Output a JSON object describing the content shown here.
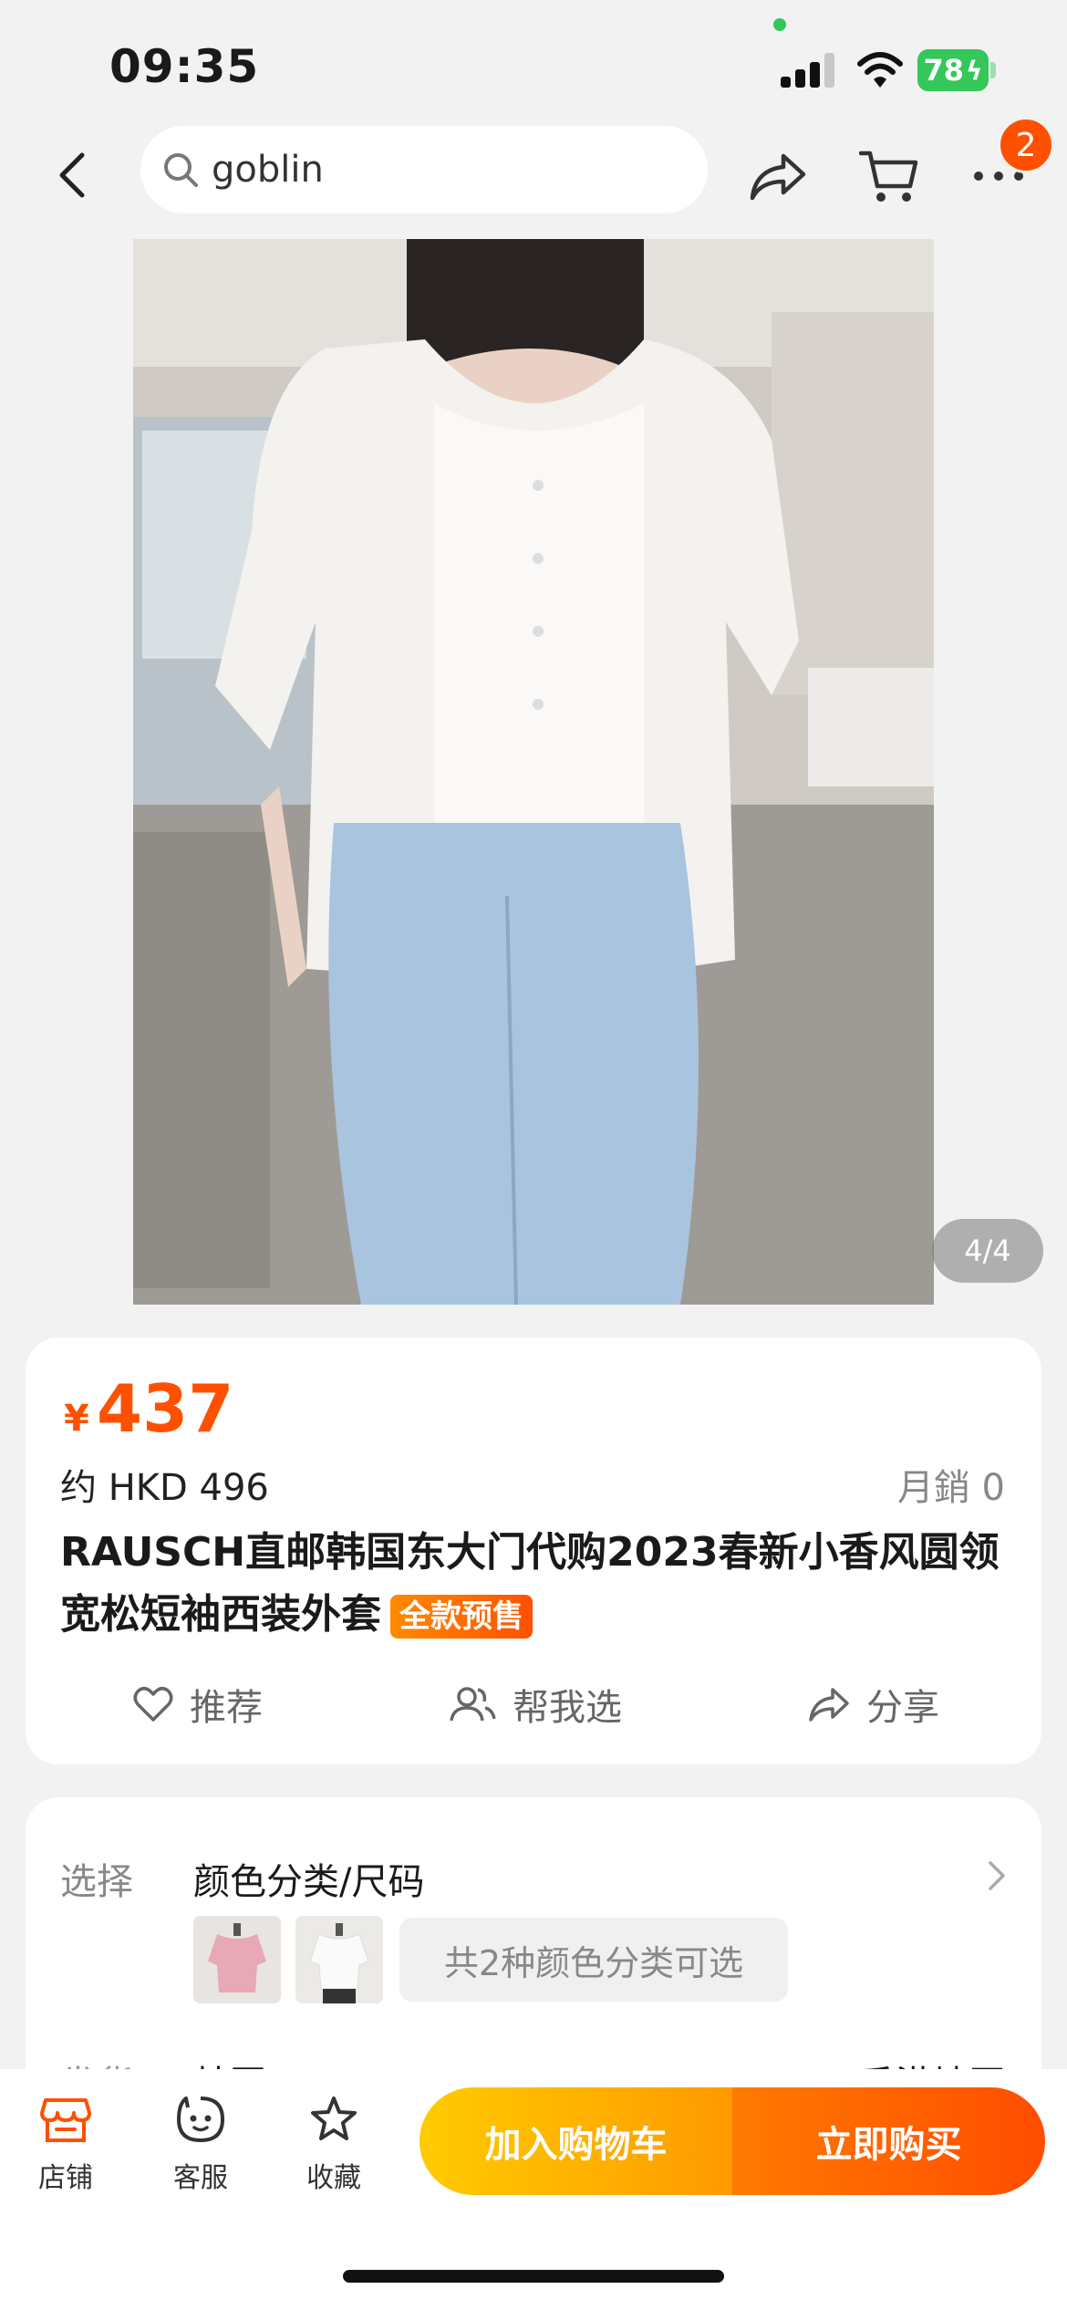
{
  "status_bar": {
    "time": "09:35",
    "battery": "78"
  },
  "nav": {
    "search_value": "goblin",
    "cart_badge": "2"
  },
  "gallery": {
    "counter": "4/4"
  },
  "product": {
    "currency_symbol": "¥",
    "price": "437",
    "approx_price": "约 HKD 496",
    "monthly_sales": "月銷 0",
    "title": "RAUSCH直邮韩国东大门代购2023春新小香风圆领宽松短袖西装外套",
    "presale_tag": "全款预售"
  },
  "actions": {
    "recommend": "推荐",
    "help_choose": "帮我选",
    "share": "分享"
  },
  "sku": {
    "label": "选择",
    "title": "颜色分类/尺码",
    "variants_note": "共2种颜色分类可选"
  },
  "peek_row": {
    "left": "发货",
    "mid": "韩国",
    "right": "香港地区"
  },
  "bottom_bar": {
    "store": "店铺",
    "service": "客服",
    "favorite": "收藏",
    "add_to_cart": "加入购物车",
    "buy_now": "立即购买"
  },
  "colors": {
    "accent": "#ff5000",
    "cart_button": "#ffb300",
    "buy_button": "#ff5a00"
  }
}
